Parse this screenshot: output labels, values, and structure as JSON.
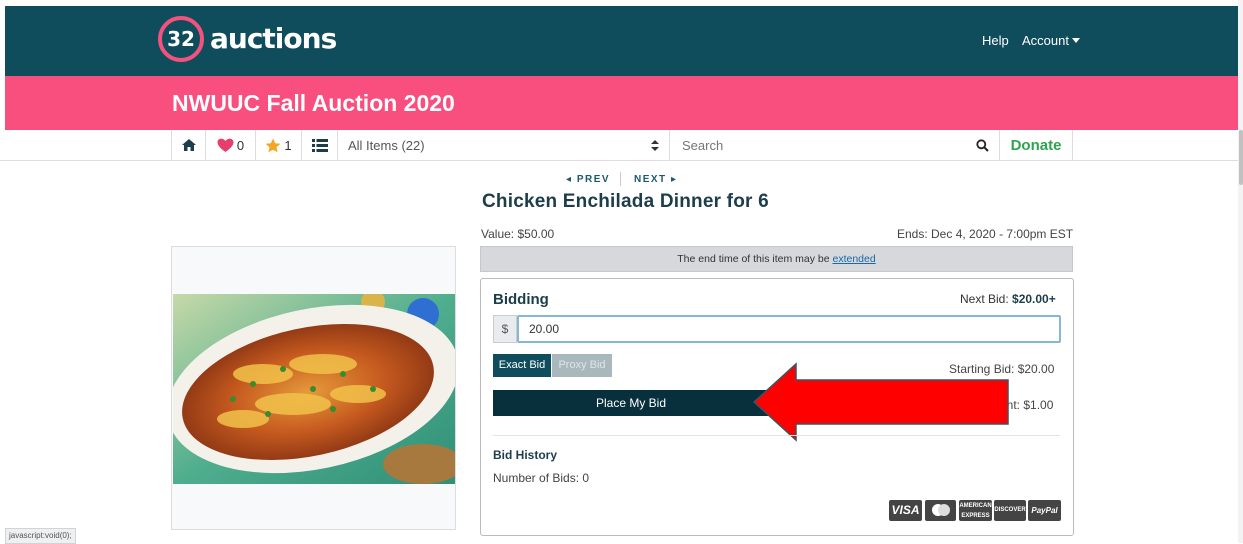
{
  "header": {
    "logo_number": "32",
    "logo_text": "auctions",
    "help_label": "Help",
    "account_label": "Account"
  },
  "event": {
    "title": "NWUUC Fall Auction 2020"
  },
  "toolbar": {
    "favorites_count": "0",
    "starred_count": "1",
    "category_selected": "All Items (22)",
    "search_placeholder": "Search",
    "donate_label": "Donate"
  },
  "item_nav": {
    "prev_label": "PREV",
    "next_label": "NEXT"
  },
  "item": {
    "title": "Chicken Enchilada Dinner for 6",
    "value_text": "Value: $50.00",
    "ends_text": "Ends: Dec 4, 2020 - 7:00pm EST",
    "notice_text": "The end time of this item may be ",
    "notice_link": "extended"
  },
  "bidding": {
    "heading": "Bidding",
    "next_bid_label": "Next Bid: ",
    "next_bid_value": "$20.00+",
    "currency_symbol": "$",
    "bid_input_value": "20.00",
    "exact_bid_label": "Exact Bid",
    "proxy_bid_label": "Proxy Bid",
    "starting_bid_text": "Starting Bid: $20.00",
    "place_bid_label": "Place My Bid",
    "increment_text": "ent: $1.00",
    "history_heading": "Bid History",
    "num_bids_text": "Number of Bids: 0"
  },
  "payment_logos": {
    "visa": "VISA",
    "amex": "AMERICAN EXPRESS",
    "discover": "DISCOVER",
    "paypal": "PayPal"
  },
  "status_bar": {
    "text": "javascript:void(0);"
  },
  "colors": {
    "header_bg": "#0f4c5c",
    "brand_pink": "#f84f7f",
    "donate_green": "#2ea44f",
    "button_dark": "#072f3c",
    "arrow_red": "#ff0000"
  }
}
